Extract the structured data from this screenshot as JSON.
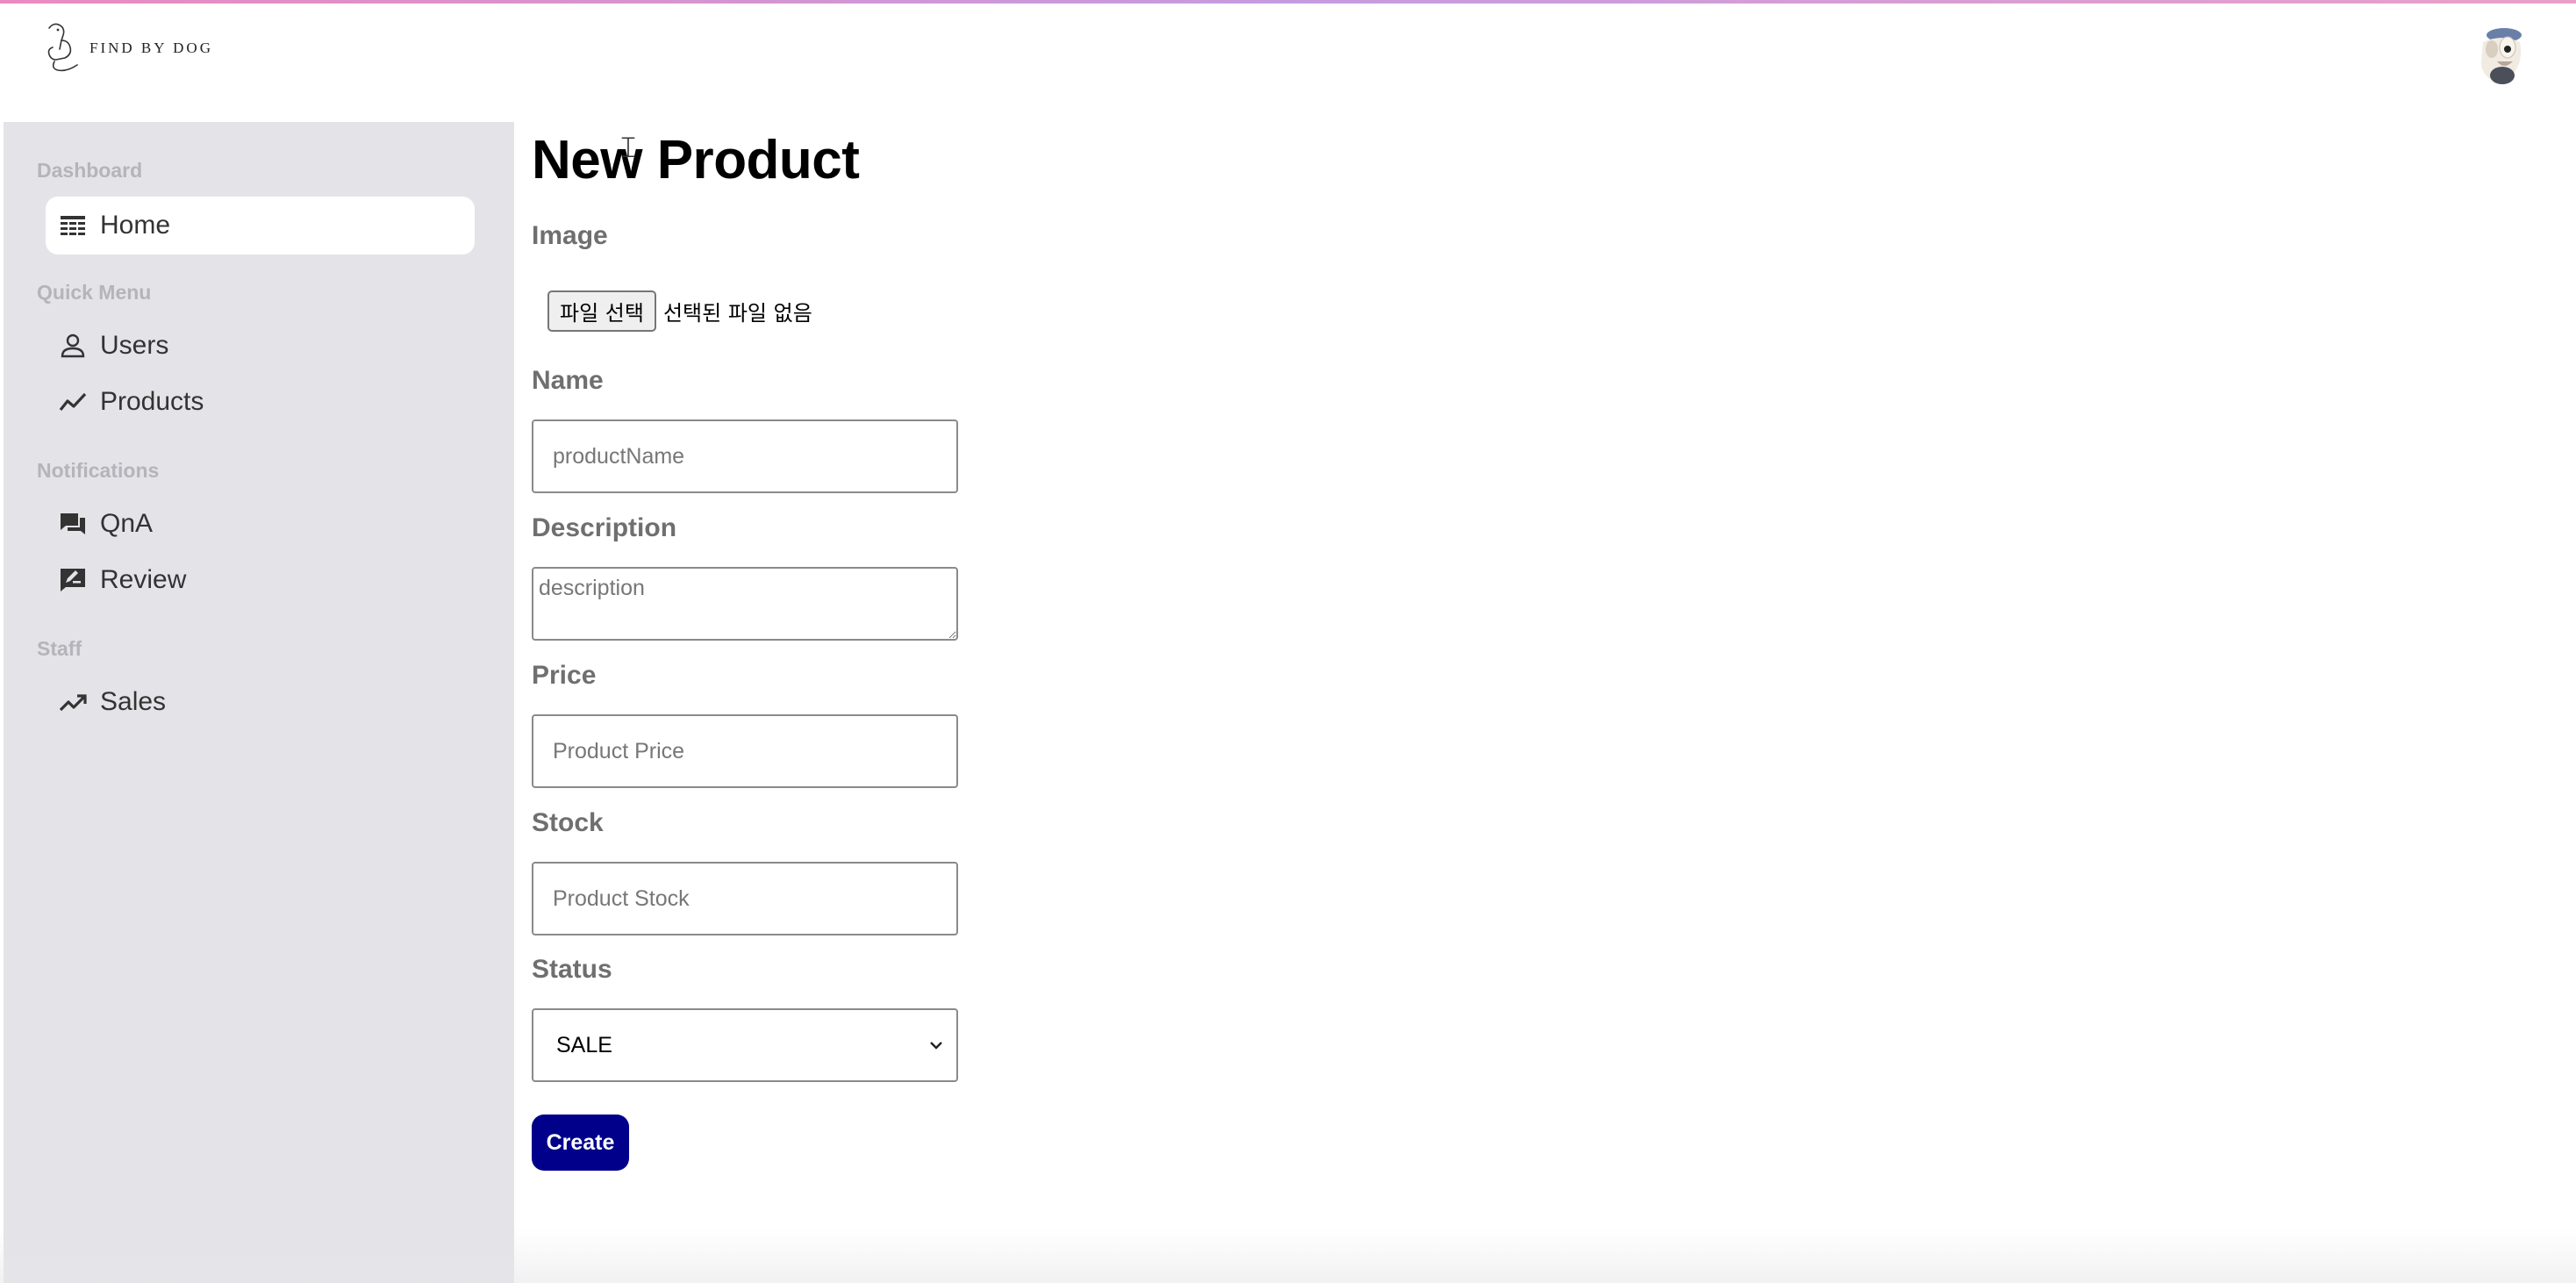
{
  "brand": {
    "logo_text": "FIND BY DOG"
  },
  "sidebar": {
    "sections": [
      {
        "title": "Dashboard"
      },
      {
        "title": "Quick Menu"
      },
      {
        "title": "Notifications"
      },
      {
        "title": "Staff"
      }
    ],
    "items": [
      {
        "label": "Home",
        "icon": "table-icon"
      },
      {
        "label": "Users",
        "icon": "person-icon"
      },
      {
        "label": "Products",
        "icon": "trend-line-icon"
      },
      {
        "label": "QnA",
        "icon": "chat-bubbles-icon"
      },
      {
        "label": "Review",
        "icon": "review-edit-icon"
      },
      {
        "label": "Sales",
        "icon": "trending-up-icon"
      }
    ],
    "active_item": "Home"
  },
  "main": {
    "title": "New Product",
    "image": {
      "label": "Image",
      "button_label": "파일 선택",
      "status_text": "선택된 파일 없음"
    },
    "name": {
      "label": "Name",
      "placeholder": "productName"
    },
    "description": {
      "label": "Description",
      "placeholder": "description"
    },
    "price": {
      "label": "Price",
      "placeholder": "Product Price"
    },
    "stock": {
      "label": "Stock",
      "placeholder": "Product Stock"
    },
    "status": {
      "label": "Status",
      "selected": "SALE"
    },
    "create_label": "Create"
  },
  "colors": {
    "sidebar_bg": "#e4e3e8",
    "create_button": "#00008b",
    "section_title": "#b5b4bb"
  }
}
